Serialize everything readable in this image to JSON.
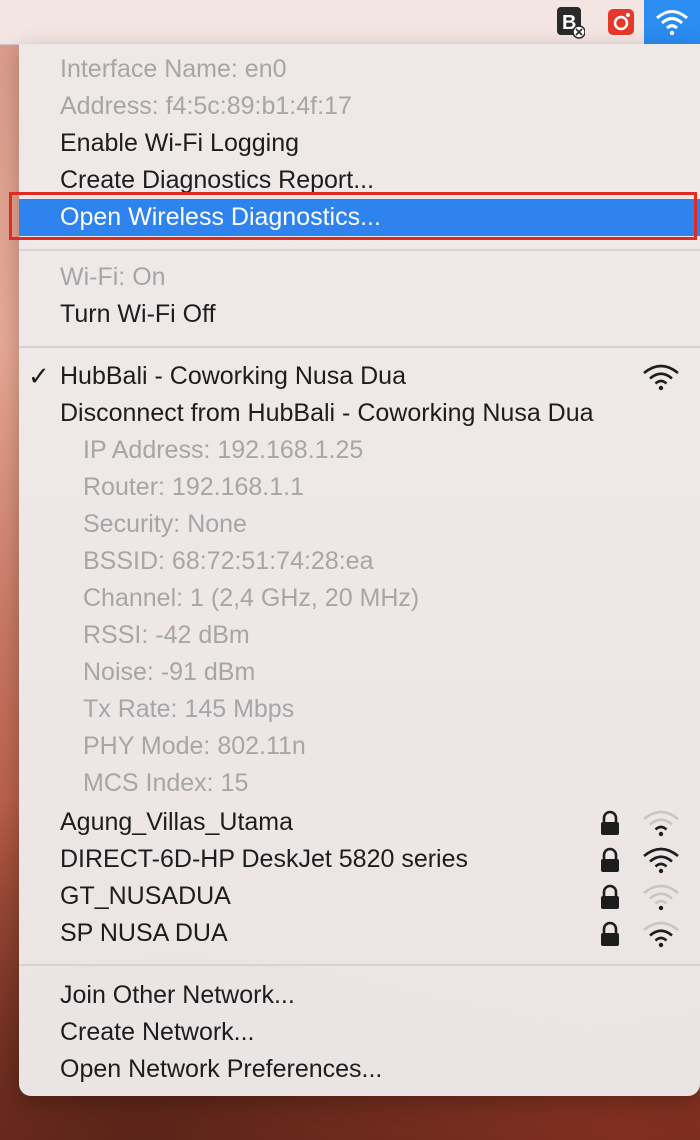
{
  "menubar": {
    "icons": [
      "extension-x-icon",
      "camera-icon",
      "wifi-icon"
    ]
  },
  "menu": {
    "interface": {
      "name": "Interface Name: en0",
      "address": "Address: f4:5c:89:b1:4f:17",
      "enable_logging": "Enable Wi-Fi Logging",
      "create_report": "Create Diagnostics Report...",
      "open_diagnostics": "Open Wireless Diagnostics..."
    },
    "wifi": {
      "status": "Wi-Fi: On",
      "toggle": "Turn Wi-Fi Off"
    },
    "current": {
      "name": "HubBali - Coworking Nusa Dua",
      "disconnect": "Disconnect from HubBali - Coworking Nusa Dua",
      "details": [
        "IP Address: 192.168.1.25",
        "Router: 192.168.1.1",
        "Security: None",
        "BSSID: 68:72:51:74:28:ea",
        "Channel: 1 (2,4 GHz, 20 MHz)",
        "RSSI: -42 dBm",
        "Noise: -91 dBm",
        "Tx Rate: 145 Mbps",
        "PHY Mode: 802.11n",
        "MCS Index: 15"
      ]
    },
    "networks": [
      {
        "name": "Agung_Villas_Utama",
        "signal_bars": 1
      },
      {
        "name": "DIRECT-6D-HP DeskJet 5820 series",
        "signal_bars": 3
      },
      {
        "name": "GT_NUSADUA",
        "signal_bars": 1
      },
      {
        "name": "SP NUSA DUA",
        "signal_bars": 2
      }
    ],
    "footer": {
      "join_other": "Join Other Network...",
      "create": "Create Network...",
      "preferences": "Open Network Preferences..."
    }
  },
  "colors": {
    "highlight": "#2f83ee",
    "annotation_box": "#e02a22",
    "disabled_text": "#a6a6a6"
  }
}
